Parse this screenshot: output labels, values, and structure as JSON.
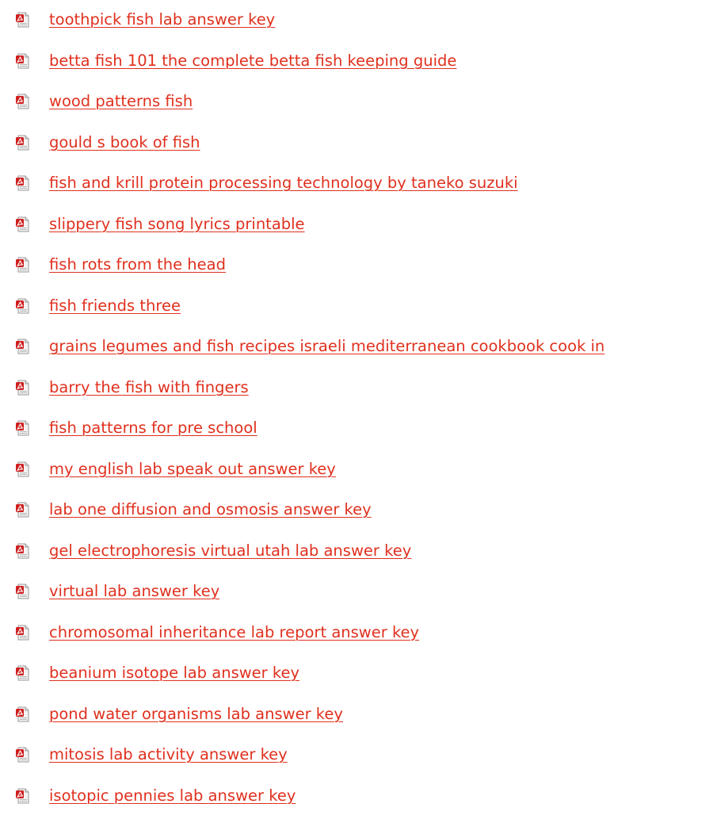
{
  "link_color": "#e0301e",
  "icon": "pdf-file-icon",
  "links": [
    {
      "label": "toothpick fish lab answer key"
    },
    {
      "label": "betta fish 101 the complete betta fish keeping guide"
    },
    {
      "label": "wood patterns fish"
    },
    {
      "label": "gould s book of fish"
    },
    {
      "label": "fish and krill protein processing technology by taneko suzuki"
    },
    {
      "label": "slippery fish song lyrics printable"
    },
    {
      "label": "fish rots from the head"
    },
    {
      "label": "fish friends three"
    },
    {
      "label": "grains legumes and fish recipes israeli mediterranean cookbook cook in"
    },
    {
      "label": "barry the fish with fingers"
    },
    {
      "label": "fish patterns for pre school"
    },
    {
      "label": "my english lab speak out answer key"
    },
    {
      "label": "lab one diffusion and osmosis answer key"
    },
    {
      "label": "gel electrophoresis virtual utah lab answer key"
    },
    {
      "label": "virtual lab answer key"
    },
    {
      "label": "chromosomal inheritance lab report answer key"
    },
    {
      "label": "beanium isotope lab answer key"
    },
    {
      "label": "pond water organisms lab answer key"
    },
    {
      "label": "mitosis lab activity answer key"
    },
    {
      "label": "isotopic pennies lab answer key"
    }
  ]
}
